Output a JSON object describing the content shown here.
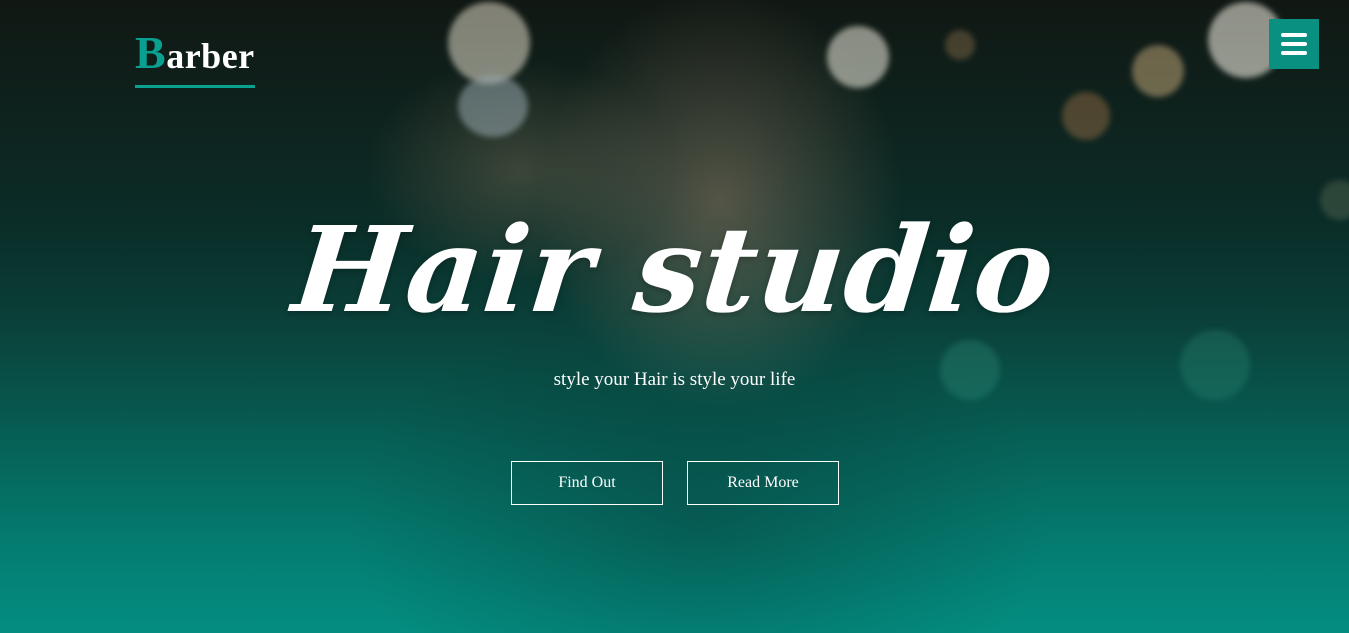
{
  "brand": {
    "initial": "B",
    "rest": "arber",
    "accent_color": "#0aa090"
  },
  "menu": {
    "icon": "hamburger-menu-icon",
    "color": "#0a9080"
  },
  "hero": {
    "title": "Hair studio",
    "subtitle": "style your Hair is style your life",
    "buttons": {
      "find_out": "Find Out",
      "read_more": "Read More"
    },
    "overlay_color": "#079085"
  }
}
